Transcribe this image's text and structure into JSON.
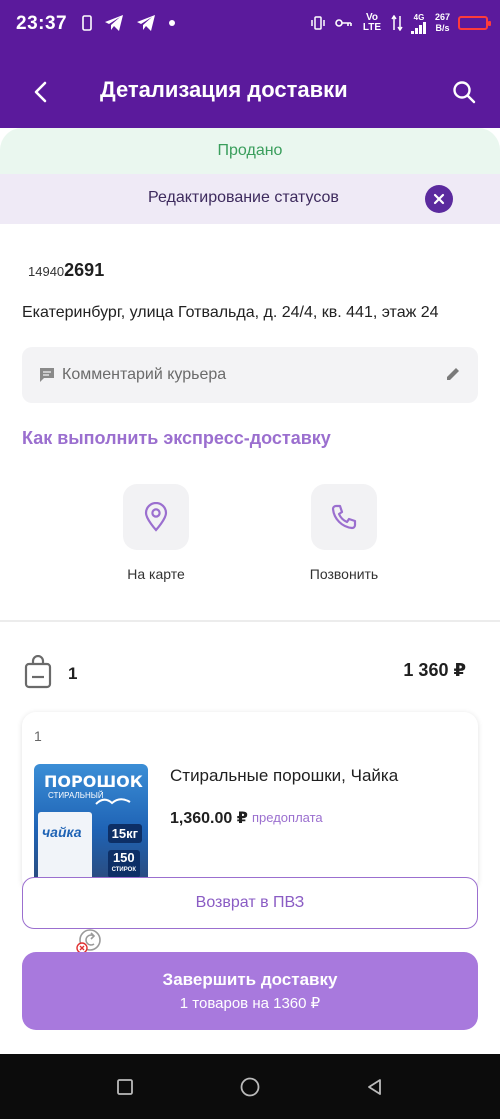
{
  "status_bar": {
    "time": "23:37",
    "network": "Vo LTE",
    "signal": "4G",
    "speed_value": "267",
    "speed_unit": "B/s"
  },
  "header": {
    "title": "Детализация доставки"
  },
  "status_banner": {
    "text": "Продано"
  },
  "edit_bar": {
    "text": "Редактирование статусов"
  },
  "order": {
    "id_prefix": "14940",
    "id_main": "2691",
    "address": "Екатеринбург, улица Готвальда, д. 24/4, кв. 441, этаж 24",
    "comment_placeholder": "Комментарий курьера",
    "express_link": "Как выполнить экспресс-доставку"
  },
  "actions": [
    {
      "label": "На карте",
      "icon": "map-pin-icon"
    },
    {
      "label": "Позвонить",
      "icon": "phone-icon"
    }
  ],
  "summary": {
    "count": "1",
    "total": "1 360 ₽"
  },
  "item": {
    "index": "1",
    "name": "Стиральные порошки, Чайка",
    "price": "1,360.00 ₽",
    "payment": "предоплата",
    "package": {
      "brand": "ПОРОШОК",
      "sub": "СТИРАЛЬНЫЙ",
      "logo": "чайка",
      "weight": "15кг",
      "washes": "150",
      "washes_label": "СТИРОК"
    }
  },
  "buttons": {
    "return": "Возврат в ПВЗ",
    "complete_title": "Завершить доставку",
    "complete_sub": "1 товаров на 1360 ₽"
  },
  "colors": {
    "header": "#5b1a9c",
    "accent": "#9b6fcf",
    "complete_button": "#a879dd",
    "sold_text": "#3a9e5c",
    "sold_bg": "#eaf7ef"
  }
}
